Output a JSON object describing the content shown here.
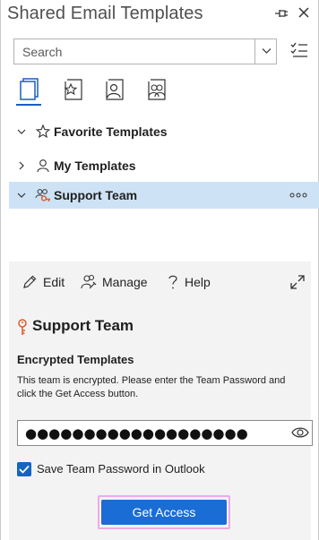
{
  "header": {
    "title": "Shared Email Templates",
    "pin_icon": "pin-icon",
    "close_icon": "close-icon"
  },
  "search": {
    "placeholder": "Search",
    "value": ""
  },
  "tabs": [
    {
      "icon": "all-templates-icon",
      "active": true
    },
    {
      "icon": "favorites-icon",
      "active": false
    },
    {
      "icon": "my-templates-icon",
      "active": false
    },
    {
      "icon": "team-templates-icon",
      "active": false
    }
  ],
  "tree": {
    "items": [
      {
        "label": "Favorite Templates",
        "icon": "star-icon",
        "expanded": true,
        "selected": false
      },
      {
        "label": "My Templates",
        "icon": "person-icon",
        "expanded": false,
        "selected": false
      },
      {
        "label": "Support Team",
        "icon": "locked-team-icon",
        "expanded": true,
        "selected": true
      }
    ]
  },
  "toolbar": {
    "edit_label": "Edit",
    "manage_label": "Manage",
    "help_label": "Help"
  },
  "details": {
    "team_name": "Support Team",
    "section_title": "Encrypted Templates",
    "description": "This team is encrypted. Please enter the Team Password and click the Get Access button.",
    "password_value": "●●●●●●●●●●●●●●●●●●●",
    "save_password_label": "Save Team Password in Outlook",
    "save_password_checked": true,
    "get_access_label": "Get Access"
  },
  "colors": {
    "accent": "#1a6dd4",
    "selected_row": "#cde3f5",
    "key_icon": "#e05a2b",
    "focus_ring": "#f0a9e7"
  }
}
